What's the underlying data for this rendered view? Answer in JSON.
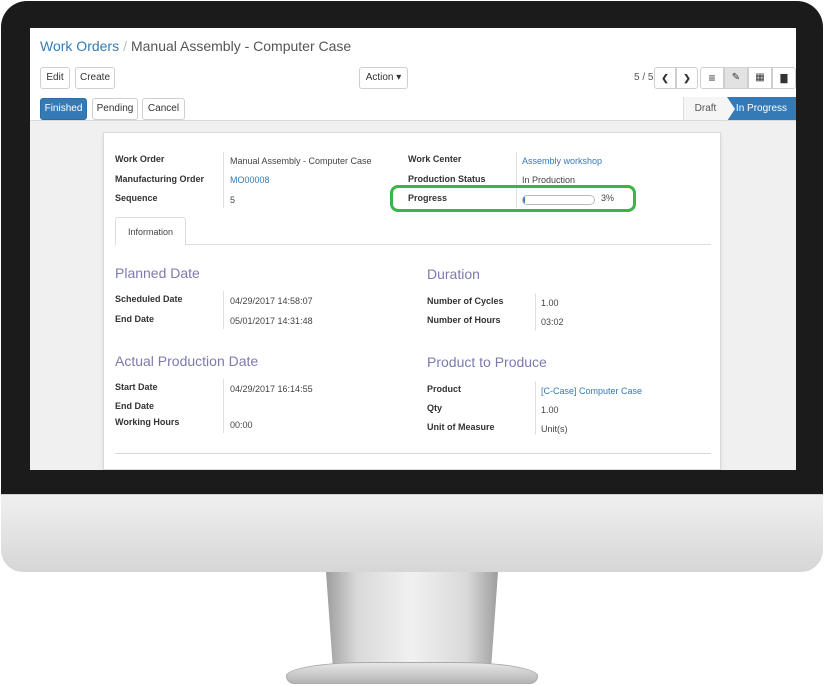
{
  "breadcrumb": {
    "parent": "Work Orders",
    "separator": "/",
    "current": "Manual Assembly - Computer Case"
  },
  "toolbar": {
    "edit": "Edit",
    "create": "Create",
    "action": "Action ▾"
  },
  "pager": {
    "text": "5 / 5",
    "prev": "❮",
    "next": "❯"
  },
  "views": {
    "list": "≡",
    "form": "✎",
    "calendar": "▦",
    "graph": "▇"
  },
  "status": {
    "finished": "Finished",
    "pending": "Pending",
    "cancel": "Cancel",
    "stages": [
      "Draft",
      "In Progress"
    ]
  },
  "header_fields": {
    "work_order_label": "Work Order",
    "work_order": "Manual Assembly - Computer Case",
    "mo_label": "Manufacturing Order",
    "mo": "MO00008",
    "sequence_label": "Sequence",
    "sequence": "5",
    "work_center_label": "Work Center",
    "work_center": "Assembly workshop",
    "prod_status_label": "Production Status",
    "prod_status": "In Production",
    "progress_label": "Progress",
    "progress_text": "3%",
    "progress_value": 0.03
  },
  "tabs": [
    "Information"
  ],
  "planned": {
    "title": "Planned Date",
    "scheduled_label": "Scheduled Date",
    "scheduled": "04/29/2017 14:58:07",
    "end_label": "End Date",
    "end": "05/01/2017 14:31:48"
  },
  "duration": {
    "title": "Duration",
    "cycles_label": "Number of Cycles",
    "cycles": "1.00",
    "hours_label": "Number of Hours",
    "hours": "03:02"
  },
  "actual": {
    "title": "Actual Production Date",
    "start_label": "Start Date",
    "start": "04/29/2017 16:14:55",
    "end_label": "End Date",
    "end": "",
    "working_label": "Working Hours",
    "working": "00:00"
  },
  "product": {
    "title": "Product to Produce",
    "product_label": "Product",
    "product": "[C-Case] Computer Case",
    "qty_label": "Qty",
    "qty": "1.00",
    "uom_label": "Unit of Measure",
    "uom": "Unit(s)"
  },
  "colors": {
    "primary": "#337ab7",
    "section_title": "#7c7bad",
    "highlight": "#39b54a"
  }
}
